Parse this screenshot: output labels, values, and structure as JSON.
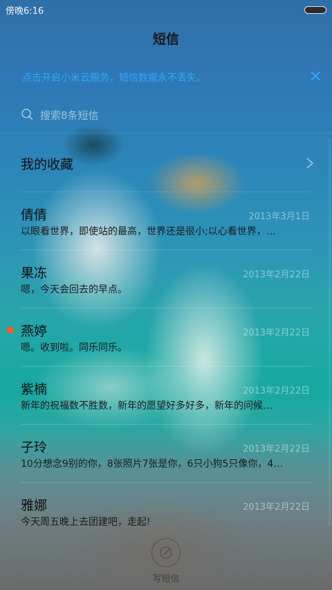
{
  "status_bar": {
    "time": "傍晚6:16"
  },
  "header": {
    "title": "短信"
  },
  "notice": {
    "text": "点击开启小米云服务，短信数据永不丢失。"
  },
  "search": {
    "placeholder": "搜索8条短信"
  },
  "favorites": {
    "label": "我的收藏"
  },
  "conversations": [
    {
      "name": "倩倩",
      "date": "2013年3月1日",
      "preview": "以眼看世界，即使站的最高，世界还是很小;以心看世界，…",
      "unread": false
    },
    {
      "name": "果冻",
      "date": "2013年2月22日",
      "preview": "嗯，今天会回去的早点。",
      "unread": false
    },
    {
      "name": "燕婷",
      "date": "2013年2月22日",
      "preview": "嗯。收到啦。同乐同乐。",
      "unread": true
    },
    {
      "name": "紫楠",
      "date": "2013年2月22日",
      "preview": "新年的祝福数不胜数，新年的愿望好多好多，新年的问候…",
      "unread": false
    },
    {
      "name": "子玲",
      "date": "2013年2月22日",
      "preview": "10分想念9别的你，8张照片7张是你，6只小狗5只像你，4…",
      "unread": false
    },
    {
      "name": "雅娜",
      "date": "2013年2月22日",
      "preview": "今天周五晚上去团建吧，走起!",
      "unread": false
    }
  ],
  "compose": {
    "label": "写短信",
    "icon": "compose-icon"
  },
  "colors": {
    "accent": "#2fa8ff",
    "unread_dot": "#ff5a1f"
  }
}
